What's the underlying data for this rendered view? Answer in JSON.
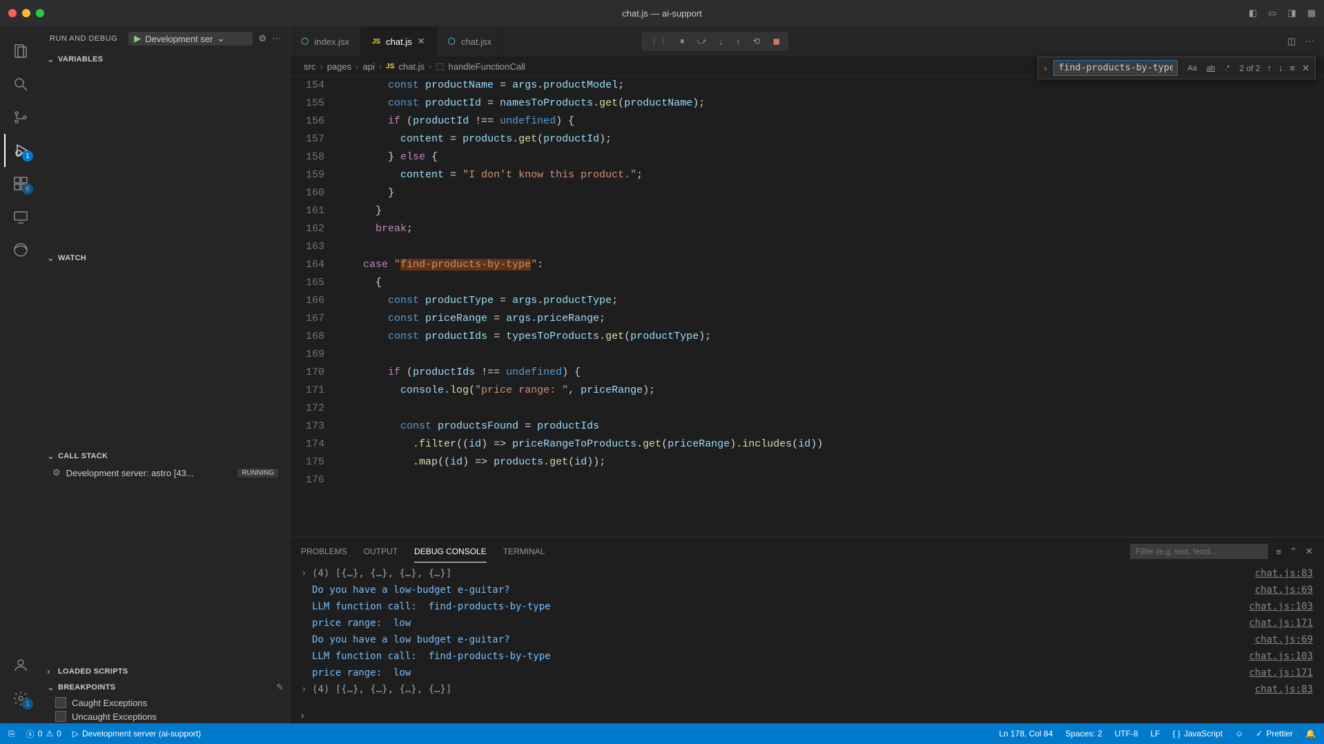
{
  "window": {
    "title": "chat.js — ai-support"
  },
  "activity": {
    "debug_badge": "1",
    "ext_badge": "6",
    "settings_badge": "1"
  },
  "sidebar": {
    "run_label": "RUN AND DEBUG",
    "config": "Development ser",
    "sections": {
      "variables": "VARIABLES",
      "watch": "WATCH",
      "callstack": "CALL STACK",
      "loaded": "LOADED SCRIPTS",
      "breakpoints": "BREAKPOINTS"
    },
    "callstack_item": "Development server: astro [43...",
    "callstack_status": "RUNNING",
    "bp_caught": "Caught Exceptions",
    "bp_uncaught": "Uncaught Exceptions"
  },
  "tabs": {
    "t1": "index.jsx",
    "t2": "chat.js",
    "t3": "chat.jsx"
  },
  "breadcrumb": {
    "p1": "src",
    "p2": "pages",
    "p3": "api",
    "p4": "chat.js",
    "p5": "handleFunctionCall"
  },
  "find": {
    "query": "find-products-by-type",
    "count": "2 of 2"
  },
  "code": {
    "lines": [
      "154",
      "155",
      "156",
      "157",
      "158",
      "159",
      "160",
      "161",
      "162",
      "163",
      "164",
      "165",
      "166",
      "167",
      "168",
      "169",
      "170",
      "171",
      "172",
      "173",
      "174",
      "175",
      "176"
    ]
  },
  "panel": {
    "tabs": {
      "problems": "PROBLEMS",
      "output": "OUTPUT",
      "debug": "DEBUG CONSOLE",
      "terminal": "TERMINAL"
    },
    "filter_placeholder": "Filter (e.g. text, !excl...",
    "console": [
      {
        "arrow": "›",
        "text": "(4) [{…}, {…}, {…}, {…}]",
        "src": "chat.js:83",
        "cls": "cl-gray"
      },
      {
        "arrow": "",
        "text": "Do you have a low-budget e-guitar?",
        "src": "chat.js:69",
        "cls": "cl-blue"
      },
      {
        "arrow": "",
        "text": "LLM function call:  find-products-by-type",
        "src": "chat.js:103",
        "cls": "cl-blue"
      },
      {
        "arrow": "",
        "text": "price range:  low",
        "src": "chat.js:171",
        "cls": "cl-blue"
      },
      {
        "arrow": "",
        "text": "Do you have a low budget e-guitar?",
        "src": "chat.js:69",
        "cls": "cl-blue"
      },
      {
        "arrow": "",
        "text": "LLM function call:  find-products-by-type",
        "src": "chat.js:103",
        "cls": "cl-blue"
      },
      {
        "arrow": "",
        "text": "price range:  low",
        "src": "chat.js:171",
        "cls": "cl-blue"
      },
      {
        "arrow": "›",
        "text": "(4) [{…}, {…}, {…}, {…}]",
        "src": "chat.js:83",
        "cls": "cl-gray"
      }
    ]
  },
  "status": {
    "errors": "0",
    "warnings": "0",
    "server": "Development server (ai-support)",
    "pos": "Ln 178, Col 84",
    "spaces": "Spaces: 2",
    "encoding": "UTF-8",
    "eol": "LF",
    "lang": "JavaScript",
    "prettier": "Prettier"
  }
}
